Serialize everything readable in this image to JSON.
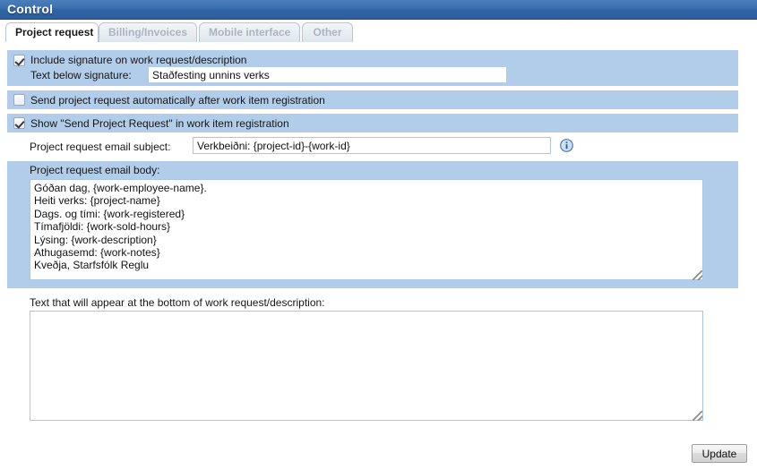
{
  "window": {
    "title": "Control"
  },
  "tabs": [
    {
      "label": "Project request",
      "active": true
    },
    {
      "label": "Billing/Invoices",
      "active": false
    },
    {
      "label": "Mobile interface",
      "active": false
    },
    {
      "label": "Other",
      "active": false
    }
  ],
  "settings": {
    "include_signature": {
      "label": "Include signature on work request/description",
      "checked": true
    },
    "text_below_signature": {
      "label": "Text below signature:",
      "value": "Staðfesting unnins verks",
      "placeholder": ""
    },
    "send_automatically": {
      "label": "Send project request automatically after work item registration",
      "checked": false
    },
    "show_send_project_request": {
      "label": "Show \"Send Project Request\" in work item registration",
      "checked": true
    },
    "email_subject": {
      "label": "Project request email subject:",
      "value": "Verkbeiðni: {project-id}-{work-id}",
      "placeholder": "",
      "info_icon": "info-icon"
    },
    "email_body": {
      "label": "Project request email body:",
      "value": "Góðan dag, {work-employee-name}.\nHeiti verks: {project-name}\nDags. og tími: {work-registered}\nTímafjöldi: {work-sold-hours}\nLýsing: {work-description}\nAthugasemd: {work-notes}\nKveðja, Starfsfólk Reglu",
      "placeholder": ""
    },
    "bottom_text": {
      "label": "Text that will appear at the bottom of work request/description:",
      "value": "",
      "placeholder": ""
    }
  },
  "footer": {
    "update_label": "Update"
  },
  "colors": {
    "titlebar_blue": "#3c72b1",
    "row_blue": "#b1cde9",
    "input_border_blue": "#a8c6e5",
    "tab_inactive_text": "#a9b5c1"
  }
}
